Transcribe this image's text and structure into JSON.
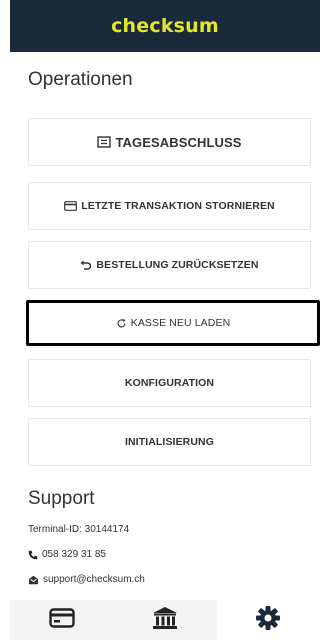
{
  "header": {
    "logo_text": "checksum"
  },
  "operations": {
    "title": "Operationen",
    "buttons": [
      {
        "label": "TAGESABSCHLUSS",
        "icon": "receipt-icon"
      },
      {
        "label": "LETZTE TRANSAKTION STORNIEREN",
        "icon": "card-icon"
      },
      {
        "label": "BESTELLUNG ZURÜCKSETZEN",
        "icon": "undo-icon"
      },
      {
        "label": "KASSE NEU LADEN",
        "icon": "reload-icon"
      },
      {
        "label": "KONFIGURATION"
      },
      {
        "label": "INITIALISIERUNG"
      }
    ]
  },
  "support": {
    "title": "Support",
    "terminal_id": "Terminal-ID: 30144174",
    "phone": "058 329 31 85",
    "email": "support@checksum.ch"
  },
  "tabbar": {
    "tabs": [
      {
        "icon": "card-icon"
      },
      {
        "icon": "bank-icon"
      },
      {
        "icon": "gear-icon",
        "active": true
      }
    ]
  },
  "colors": {
    "header_bg": "#1b2a3a",
    "logo": "#e3e829"
  }
}
